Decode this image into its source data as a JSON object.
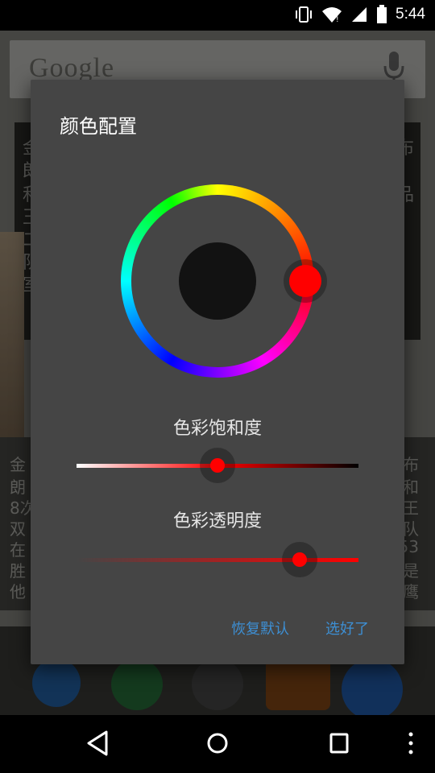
{
  "status_bar": {
    "time": "5:44",
    "icons": [
      "vibrate-icon",
      "wifi-icon",
      "signal-icon",
      "battery-icon"
    ]
  },
  "background": {
    "search_logo": "Google",
    "widget_chars_left": [
      "金",
      "朗",
      "和",
      "王",
      "二",
      "队",
      "室"
    ],
    "widget_chars_right": [
      "布",
      "品"
    ],
    "news_left": [
      "金",
      "朗",
      "8次",
      "双",
      "在",
      "胜",
      "他"
    ],
    "news_right": [
      "布",
      "和",
      "王",
      "队",
      "53",
      "是",
      "鹰"
    ]
  },
  "dialog": {
    "title": "颜色配置",
    "selected_color": "#ff0000",
    "saturation_label": "色彩饱和度",
    "saturation_value": 0.5,
    "alpha_label": "色彩透明度",
    "alpha_value": 0.79,
    "reset_button": "恢复默认",
    "confirm_button": "选好了",
    "accent_color": "#3d8fd4"
  },
  "nav": {
    "back": "back-icon",
    "home": "home-icon",
    "recents": "recents-icon",
    "menu": "overflow-menu-icon"
  }
}
